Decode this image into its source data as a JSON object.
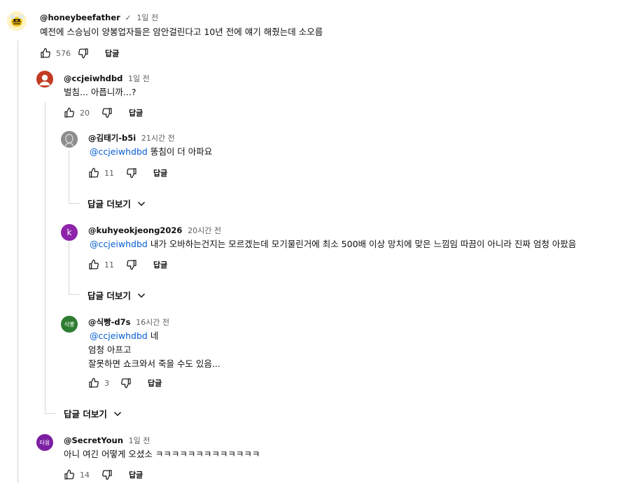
{
  "comments": {
    "top": {
      "author": "@honeybeefather",
      "verified_mark": "✓",
      "time": "1일 전",
      "text": "예전에 스승님이 양봉업자들은 암안걸린다고 10년 전에 얘기 해줬는데 소오름",
      "likes": "576",
      "reply_label": "답글"
    },
    "reply1": {
      "author": "@ccjeiwhdbd",
      "time": "1일 전",
      "text": "벌침... 아픕니까...?",
      "likes": "20",
      "reply_label": "답글",
      "avatar_color": "#c23b22"
    },
    "reply1_1": {
      "author": "@김태기-b5i",
      "time": "21시간 전",
      "mention": "@ccjeiwhdbd",
      "text": " 똥침이 더 아파요",
      "likes": "11",
      "reply_label": "답글",
      "avatar_color": "#8d8d8d"
    },
    "more1": "답글 더보기",
    "reply1_2": {
      "author": "@kuhyeokjeong2026",
      "time": "20시간 전",
      "avatar_initial": "k",
      "mention": "@ccjeiwhdbd",
      "text": " 내가 오바하는건지는 모르겠는데 모기물린거에 최소 500배 이상 망치에 맞은 느낌임 따끔이 아니라 진짜 엄청 아팠음",
      "likes": "11",
      "reply_label": "답글",
      "avatar_color": "#8e24aa"
    },
    "more2": "답글 더보기",
    "reply1_3": {
      "author": "@식빵-d7s",
      "time": "16시간 전",
      "avatar_initial": "식빵",
      "mention": "@ccjeiwhdbd",
      "text_line1": " 네",
      "text_line2": "엄청 아프고",
      "text_line3": "잘못하면 쇼크와서 죽을 수도 있음...",
      "likes": "3",
      "reply_label": "답글",
      "avatar_color": "#2e7d32"
    },
    "more3": "답글 더보기",
    "reply2": {
      "author": "@SecretYoun",
      "time": "1일 전",
      "avatar_initial": "타용",
      "text": "아니 여긴 어떻게 오셨소 ㅋㅋㅋㅋㅋㅋㅋㅋㅋㅋㅋㅋㅋ",
      "likes": "14",
      "reply_label": "답글",
      "avatar_color": "#7b1fa2"
    }
  }
}
